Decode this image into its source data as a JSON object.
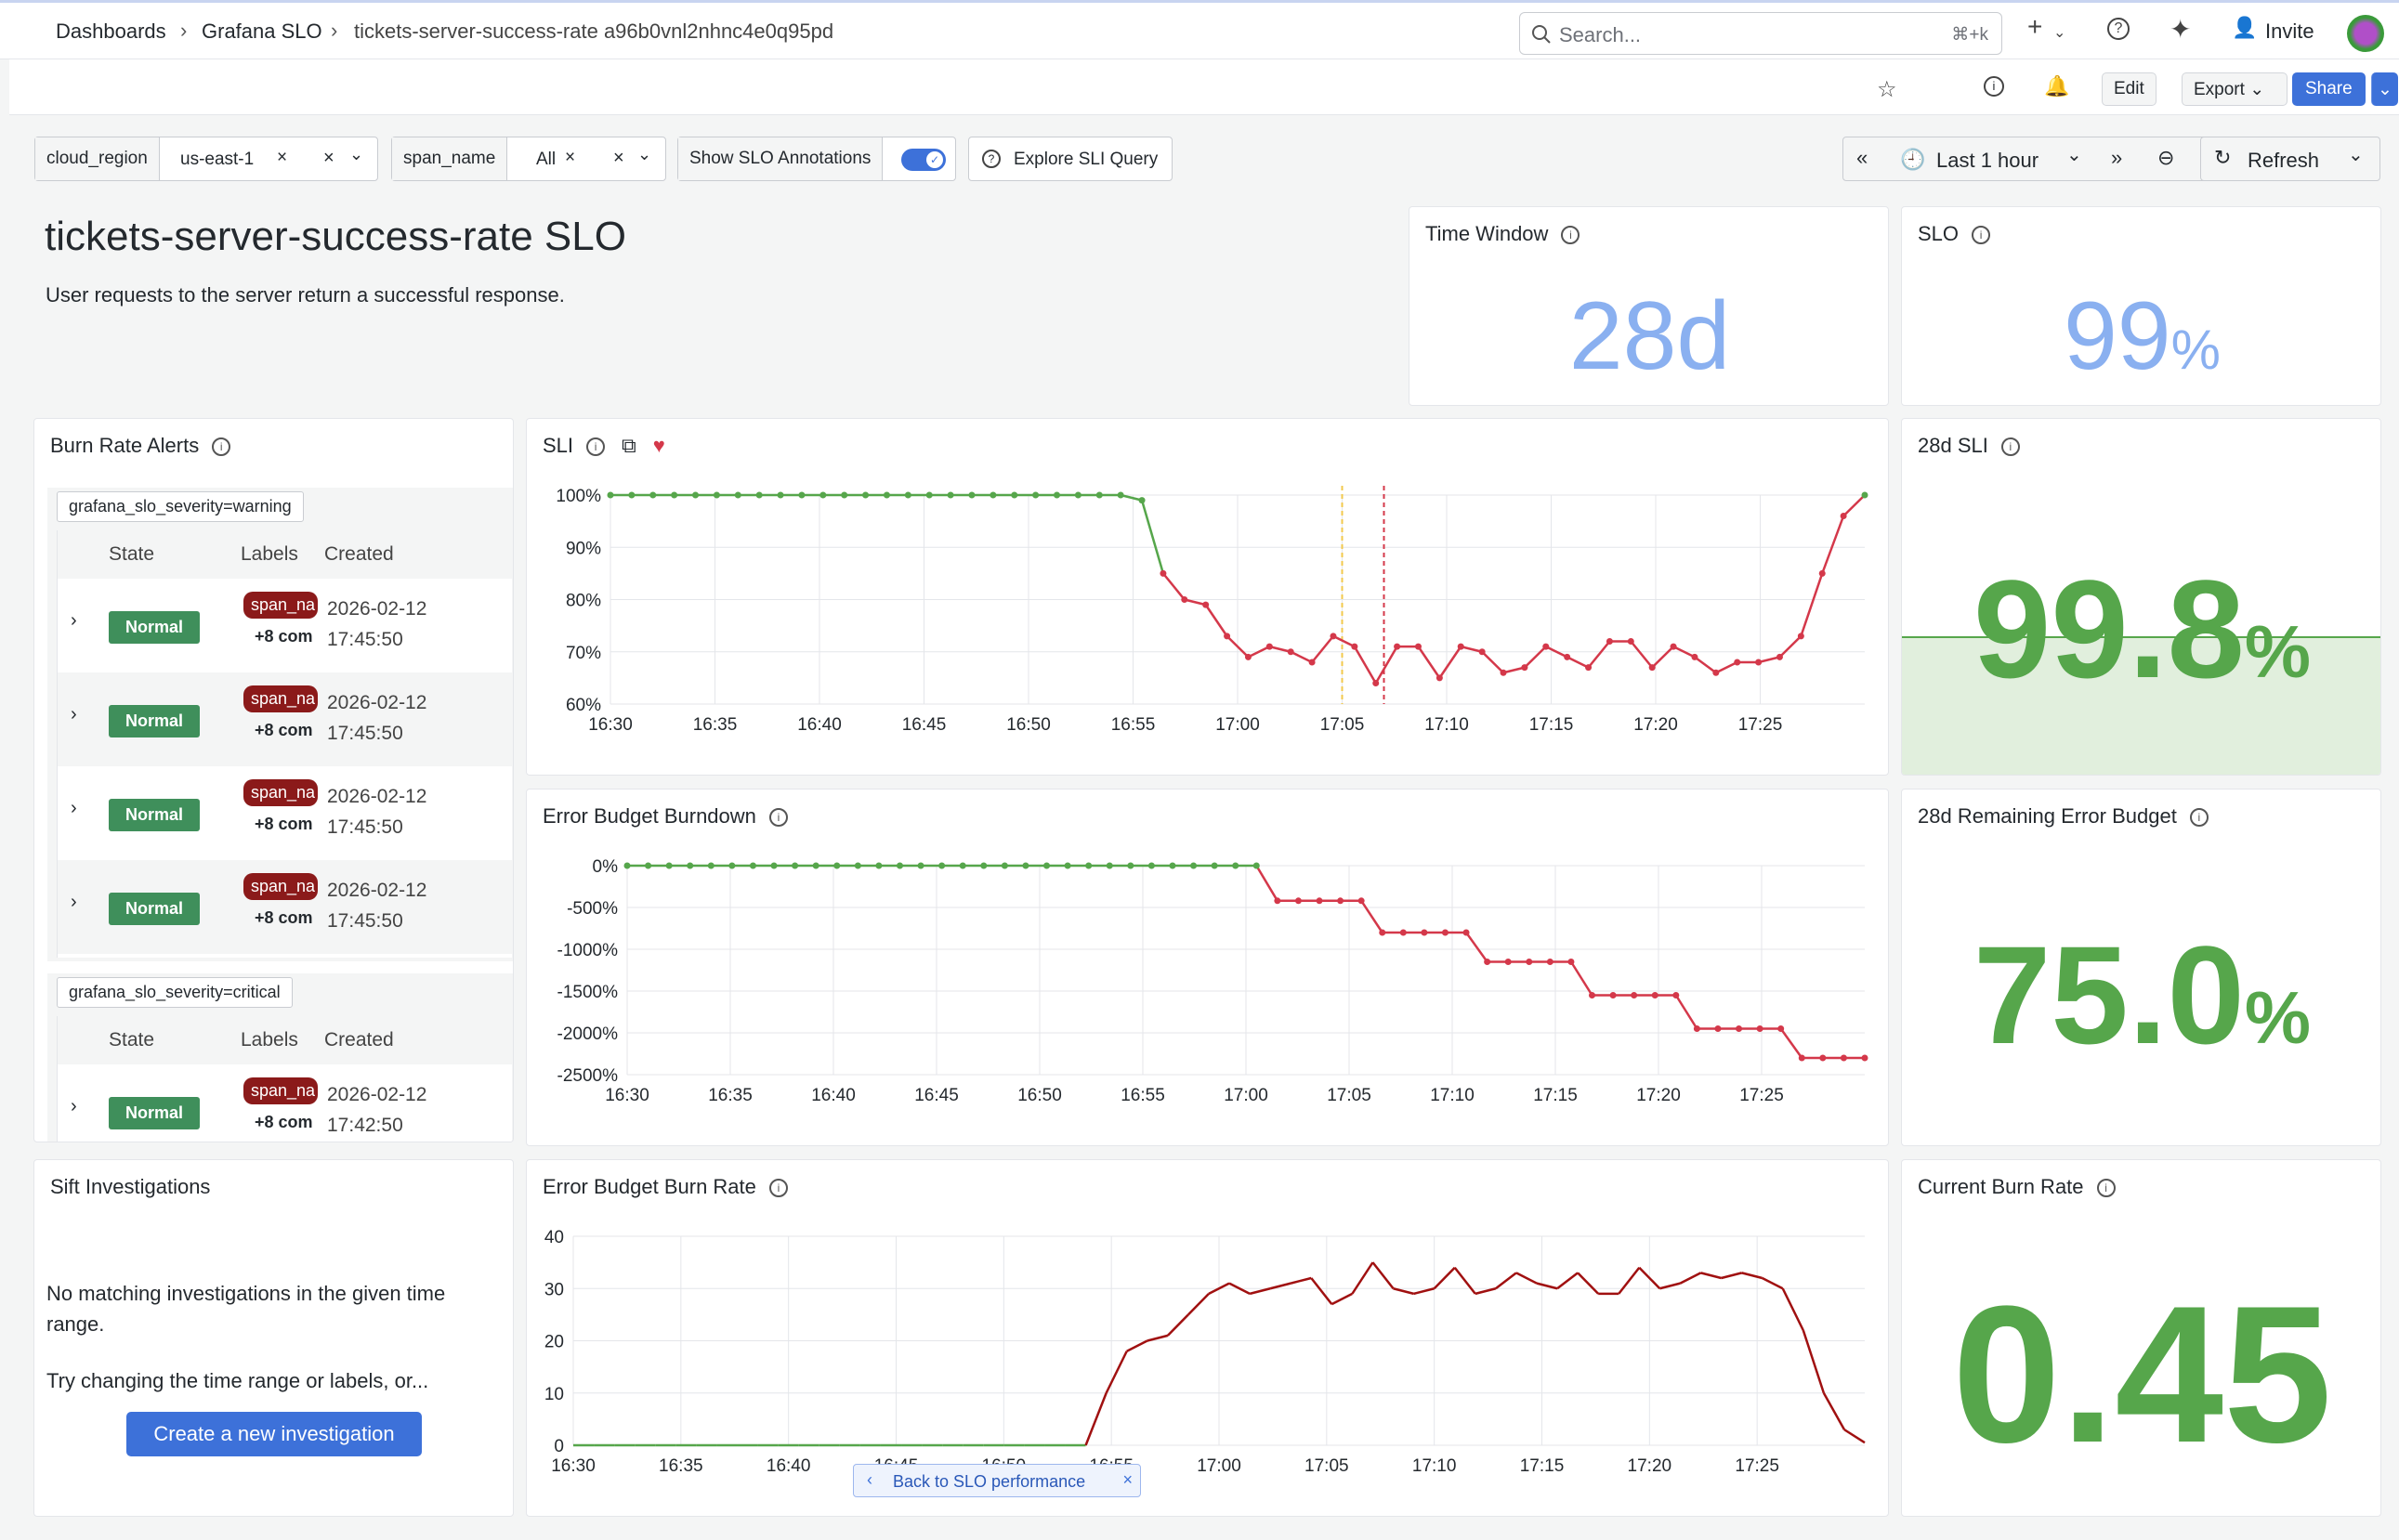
{
  "breadcrumb": {
    "item1": "Dashboards",
    "item2": "Grafana SLO",
    "item3": "tickets-server-success-rate a96b0vnl2nhnc4e0q95pd"
  },
  "search": {
    "placeholder": "Search...",
    "shortcut": "⌘+k"
  },
  "topnav": {
    "invite": "Invite"
  },
  "toolbar": {
    "edit": "Edit",
    "export": "Export",
    "share": "Share"
  },
  "vars": {
    "cloud_region_label": "cloud_region",
    "cloud_region_value": "us-east-1",
    "span_name_label": "span_name",
    "span_name_value": "All",
    "annotations_label": "Show SLO Annotations",
    "explore_label": "Explore SLI Query"
  },
  "timepicker": {
    "range": "Last 1 hour",
    "refresh": "Refresh"
  },
  "header": {
    "title": "tickets-server-success-rate SLO",
    "description": "User requests to the server return a successful response."
  },
  "time_window": {
    "title": "Time Window",
    "value": "28d"
  },
  "slo": {
    "title": "SLO",
    "value": "99",
    "unit": "%"
  },
  "burn_rate_alerts": {
    "title": "Burn Rate Alerts",
    "group1": "grafana_slo_severity=warning",
    "group2": "grafana_slo_severity=critical",
    "col_state": "State",
    "col_labels": "Labels",
    "col_created": "Created",
    "rows": [
      {
        "state": "Normal",
        "label": "span_na",
        "more": "+8 com",
        "date": "2026-02-12",
        "time": "17:45:50"
      },
      {
        "state": "Normal",
        "label": "span_na",
        "more": "+8 com",
        "date": "2026-02-12",
        "time": "17:45:50"
      },
      {
        "state": "Normal",
        "label": "span_na",
        "more": "+8 com",
        "date": "2026-02-12",
        "time": "17:45:50"
      },
      {
        "state": "Normal",
        "label": "span_na",
        "more": "+8 com",
        "date": "2026-02-12",
        "time": "17:45:50"
      }
    ],
    "critical_row": {
      "state": "Normal",
      "label": "span_na",
      "more": "+8 com",
      "date": "2026-02-12",
      "time": "17:42:50"
    }
  },
  "sli_28d": {
    "title": "28d SLI",
    "value": "99.8",
    "unit": "%"
  },
  "remaining_budget": {
    "title": "28d Remaining Error Budget",
    "value": "75.0",
    "unit": "%"
  },
  "current_burn": {
    "title": "Current Burn Rate",
    "value": "0.45"
  },
  "sift": {
    "title": "Sift Investigations",
    "msg1": "No matching investigations in the given time range.",
    "msg2": "Try changing the time range or labels, or...",
    "button": "Create a new investigation"
  },
  "back_banner": {
    "label": "Back to SLO performance"
  },
  "colors": {
    "green": "#56a64b",
    "red": "#d4384a",
    "blue": "#3d71d9",
    "bignum_blue": "#8ab0f0"
  },
  "chart_data": [
    {
      "title": "SLI",
      "type": "line",
      "yticks": [
        "100%",
        "90%",
        "80%",
        "70%",
        "60%"
      ],
      "ylim": [
        60,
        100
      ],
      "xticks": [
        "16:30",
        "16:35",
        "16:40",
        "16:45",
        "16:50",
        "16:55",
        "17:00",
        "17:05",
        "17:10",
        "17:15",
        "17:20",
        "17:25"
      ],
      "series": [
        {
          "values": [
            100,
            100,
            100,
            100,
            100,
            100,
            100,
            100,
            100,
            100,
            100,
            100,
            100,
            100,
            100,
            100,
            100,
            100,
            100,
            100,
            100,
            100,
            100,
            100,
            100,
            99,
            85,
            80,
            79,
            73,
            69,
            71,
            70,
            68,
            73,
            71,
            64,
            71,
            71,
            65,
            71,
            70,
            66,
            67,
            71,
            69,
            67,
            72,
            72,
            67,
            71,
            69,
            66,
            68,
            68,
            69,
            73,
            85,
            96,
            100
          ]
        }
      ],
      "markers": [
        {
          "x": "17:05"
        },
        {
          "x": "17:07"
        }
      ]
    },
    {
      "title": "Error Budget Burndown",
      "type": "line",
      "yticks": [
        "0%",
        "-500%",
        "-1000%",
        "-1500%",
        "-2000%",
        "-2500%"
      ],
      "ylim": [
        -2500,
        0
      ],
      "xticks": [
        "16:30",
        "16:35",
        "16:40",
        "16:45",
        "16:50",
        "16:55",
        "17:00",
        "17:05",
        "17:10",
        "17:15",
        "17:20",
        "17:25"
      ],
      "series": [
        {
          "values": [
            0,
            0,
            0,
            0,
            0,
            0,
            0,
            0,
            0,
            0,
            0,
            0,
            0,
            0,
            0,
            0,
            0,
            0,
            0,
            0,
            0,
            0,
            0,
            0,
            0,
            0,
            0,
            0,
            0,
            0,
            0,
            -420,
            -420,
            -420,
            -420,
            -420,
            -800,
            -800,
            -800,
            -800,
            -800,
            -1150,
            -1150,
            -1150,
            -1150,
            -1150,
            -1550,
            -1550,
            -1550,
            -1550,
            -1550,
            -1950,
            -1950,
            -1950,
            -1950,
            -1950,
            -2300,
            -2300,
            -2300,
            -2300
          ]
        }
      ]
    },
    {
      "title": "Error Budget Burn Rate",
      "type": "line",
      "yticks": [
        "40",
        "30",
        "20",
        "10",
        "0"
      ],
      "ylim": [
        0,
        40
      ],
      "xticks": [
        "16:30",
        "16:35",
        "16:40",
        "16:45",
        "16:50",
        "16:55",
        "17:00",
        "17:05",
        "17:10",
        "17:15",
        "17:20",
        "17:25"
      ],
      "series": [
        {
          "values": [
            0,
            0,
            0,
            0,
            0,
            0,
            0,
            0,
            0,
            0,
            0,
            0,
            0,
            0,
            0,
            0,
            0,
            0,
            0,
            0,
            0,
            0,
            0,
            0,
            0,
            0,
            10,
            18,
            20,
            21,
            25,
            29,
            31,
            29,
            30,
            31,
            32,
            27,
            29,
            35,
            30,
            29,
            30,
            34,
            29,
            30,
            33,
            31,
            30,
            33,
            29,
            29,
            34,
            30,
            31,
            33,
            32,
            33,
            32,
            30,
            22,
            10,
            3,
            0.5
          ]
        }
      ]
    }
  ]
}
